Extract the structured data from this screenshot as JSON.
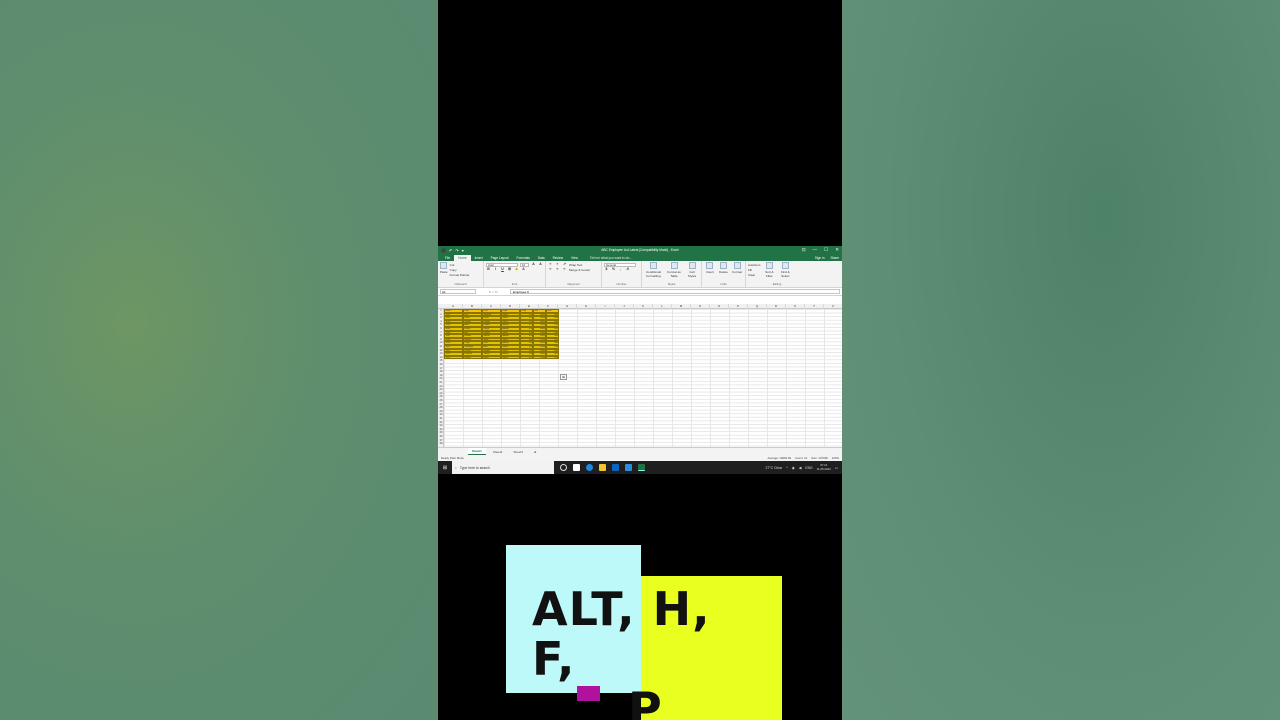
{
  "excel": {
    "title": "ABC Employee List Latest  [Compatibility Mode]  -  Excel",
    "qat": [
      "⬛",
      "↶",
      "↷",
      "▾"
    ],
    "window_buttons": [
      "⊡",
      "—",
      "☐",
      "✕"
    ],
    "tabs": [
      "File",
      "Home",
      "Insert",
      "Page Layout",
      "Formulas",
      "Data",
      "Review",
      "View"
    ],
    "tell_me": "Tell me what you want to do...",
    "sign_in": "Sign in",
    "share": "Share",
    "ribbon": {
      "paste": "Paste",
      "cut": "Cut",
      "copy": "Copy",
      "format_painter": "Format Painter",
      "font_name": "Arial",
      "font_size": "10",
      "wrap_text": "Wrap Text",
      "merge_center": "Merge & Center",
      "number_format": "General",
      "conditional_formatting": "Conditional Formatting",
      "format_as_table": "Format as Table",
      "cell_styles": "Cell Styles",
      "insert": "Insert",
      "delete": "Delete",
      "format": "Format",
      "autosum": "AutoSum",
      "fill": "Fill",
      "clear": "Clear",
      "sort_filter": "Sort & Filter",
      "find_select": "Find & Select",
      "group_labels": [
        "Clipboard",
        "Font",
        "Alignment",
        "Number",
        "Styles",
        "Cells",
        "Editing"
      ]
    },
    "name_box": "A1",
    "formula_value": "Employee #",
    "columns": [
      "A",
      "B",
      "C",
      "D",
      "E",
      "F",
      "G",
      "H",
      "I",
      "J",
      "K",
      "L",
      "M",
      "N",
      "O",
      "P",
      "Q",
      "R",
      "S",
      "T",
      "U"
    ],
    "rows": [
      "1",
      "2",
      "3",
      "4",
      "5",
      "6",
      "7",
      "8",
      "9",
      "10",
      "11",
      "12",
      "13",
      "14",
      "15",
      "16",
      "17",
      "18",
      "19",
      "20",
      "21",
      "22",
      "23",
      "24",
      "25",
      "26",
      "27",
      "28",
      "29",
      "30",
      "31",
      "32",
      "33",
      "34",
      "35",
      "36",
      "37",
      "38"
    ],
    "table": {
      "headers": [
        "Emp #",
        "First",
        "Last",
        "Dept",
        "Date",
        "Sal",
        "Bon"
      ],
      "rows": [
        [
          "1001",
          "Raj",
          "Sharma",
          "Sales",
          "4/1",
          "5000",
          "500"
        ],
        [
          "1002",
          "Sunil",
          "Patel",
          "Sales",
          "4/1",
          "5200",
          "520"
        ],
        [
          "1003",
          "Sunita",
          "Kumar",
          "Sales",
          "4/2",
          "4800",
          "480"
        ],
        [
          "1004",
          "Amit",
          "Gupta",
          "Admin",
          "4/2",
          "5100",
          "510"
        ],
        [
          "1005",
          "Rahul",
          "Singh",
          "Admin",
          "4/3",
          "4900",
          "490"
        ],
        [
          "1006",
          "Anil",
          "Verma",
          "Sales",
          "4/3",
          "5300",
          "530"
        ],
        [
          "1007",
          "Rohan",
          "Mehta",
          "Admin",
          "4/4",
          "5000",
          "500"
        ],
        [
          "1008",
          "Mohan",
          "Joshi",
          "Sales",
          "4/4",
          "4700",
          "470"
        ],
        [
          "1009",
          "Priya",
          "Rao",
          "Admin",
          "4/5",
          "5400",
          "540"
        ],
        [
          "1010",
          "Sandhya",
          "Nair",
          "Sales",
          "4/5",
          "5100",
          "510"
        ],
        [
          "1011",
          "Kavita",
          "Reddy",
          "Sales",
          "4/6",
          "4950",
          "495"
        ],
        [
          "1012",
          "Deepak",
          "Yadav",
          "Admin",
          "4/6",
          "5050",
          "505"
        ],
        [
          "1013",
          "Kishor",
          "Bajaj",
          "Sales",
          "4/7",
          "5150",
          "515"
        ]
      ]
    },
    "sheets": [
      "Sheet1",
      "Sheet2",
      "Sheet3"
    ],
    "add_sheet": "⊕",
    "status": {
      "left": "Ready   Filter Mode",
      "average": "Average: 10000.69",
      "count": "Count: 14",
      "sum": "Sum: 107090",
      "zoom": "100%"
    }
  },
  "taskbar": {
    "search_placeholder": "Type here to search",
    "weather": "27°C  Clear",
    "lang": "ENG",
    "time": "07:14",
    "date": "11-05-2022"
  },
  "overlay": {
    "shortcut_line1": "ALT, H, F,",
    "shortcut_line2": "P"
  },
  "colors": {
    "excel_green": "#217346",
    "table_fill": "#e3c400",
    "note_blue": "#bdf9f9",
    "note_yellow": "#e9ff1f",
    "marker": "#b0129d"
  }
}
